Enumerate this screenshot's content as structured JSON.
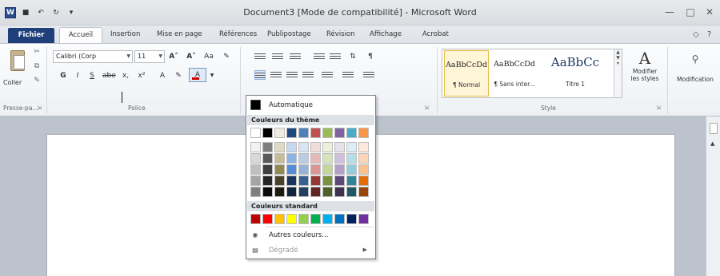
{
  "window": {
    "title": "Document3 [Mode de compatibilité] - Microsoft Word",
    "app_icon": "W"
  },
  "tabs": [
    "Fichier",
    "Accueil",
    "Insertion",
    "Mise en page",
    "Références",
    "Publipostage",
    "Révision",
    "Affichage",
    "Acrobat"
  ],
  "ribbon": {
    "clipboard": {
      "paste_label": "Coller",
      "group_label": "Presse-pa..."
    },
    "font": {
      "font_name": "Calibri (Corp",
      "font_size": "11",
      "bold": "G",
      "italic": "I",
      "underline": "S",
      "strike": "abe",
      "subscript": "x,",
      "superscript": "x²",
      "grow": "A˄",
      "shrink": "A˅",
      "case": "Aa",
      "font_color": "A",
      "group_label": "Police"
    },
    "styles": {
      "items": [
        {
          "sample": "AaBbCcDd",
          "name": "¶ Normal"
        },
        {
          "sample": "AaBbCcDd",
          "name": "¶ Sans inter..."
        },
        {
          "sample": "AaBbCc",
          "name": "Titre 1"
        }
      ],
      "modify_label": "Modifier les styles",
      "group_label": "Style"
    },
    "editing": {
      "label": "Modification"
    }
  },
  "color_menu": {
    "automatic": "Automatique",
    "theme_header": "Couleurs du thème",
    "standard_header": "Couleurs standard",
    "more_colors": "Autres couleurs...",
    "gradient": "Dégradé",
    "theme_colors": [
      [
        "#ffffff",
        "#000000",
        "#eeece1",
        "#1f497d",
        "#4f81bd",
        "#c0504d",
        "#9bbb59",
        "#8064a2",
        "#4bacc6",
        "#f79646"
      ],
      [
        "#f2f2f2",
        "#7f7f7f",
        "#ddd9c3",
        "#c6d9f0",
        "#dbe5f1",
        "#f2dcdb",
        "#ebf1dd",
        "#e5e0ec",
        "#dbeef3",
        "#fdeada"
      ],
      [
        "#d8d8d8",
        "#595959",
        "#c4bd97",
        "#8db3e2",
        "#b8cce4",
        "#e5b9b7",
        "#d7e3bc",
        "#ccc1d9",
        "#b7dde8",
        "#fbd5b5"
      ],
      [
        "#bfbfbf",
        "#3f3f3f",
        "#938953",
        "#548dd4",
        "#95b3d7",
        "#d99694",
        "#c3d69b",
        "#b2a2c7",
        "#92cddc",
        "#fac08f"
      ],
      [
        "#a5a5a5",
        "#262626",
        "#494429",
        "#17365d",
        "#366092",
        "#953734",
        "#76923c",
        "#5f497a",
        "#31859b",
        "#e36c09"
      ],
      [
        "#7f7f7f",
        "#0c0c0c",
        "#1d1b10",
        "#0f243e",
        "#244061",
        "#632423",
        "#4f6128",
        "#3f3151",
        "#205867",
        "#974806"
      ]
    ],
    "standard_colors": [
      "#c00000",
      "#ff0000",
      "#ffc000",
      "#ffff00",
      "#92d050",
      "#00b050",
      "#00b0f0",
      "#0070c0",
      "#002060",
      "#7030a0"
    ]
  }
}
